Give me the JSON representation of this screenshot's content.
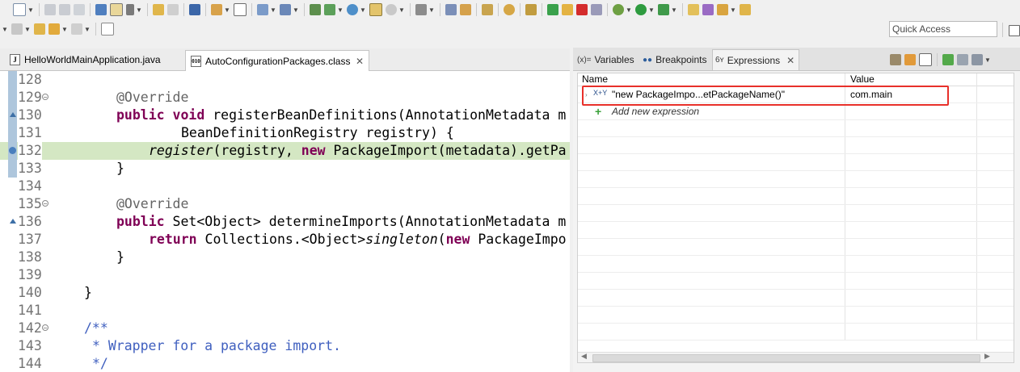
{
  "toolbar": {
    "quick_access_placeholder": "Quick Access"
  },
  "editor": {
    "tabs": [
      {
        "label": "HelloWorldMainApplication.java",
        "icon": "java-file-icon"
      },
      {
        "label": "AutoConfigurationPackages.class",
        "icon": "class-file-icon",
        "active": true
      }
    ],
    "lines": [
      {
        "num": "128",
        "text": ""
      },
      {
        "num": "129",
        "text": "@Override"
      },
      {
        "num": "130",
        "text": "public void registerBeanDefinitions(AnnotationMetadata m"
      },
      {
        "num": "131",
        "text": "BeanDefinitionRegistry registry) {"
      },
      {
        "num": "132",
        "text": "register(registry, new PackageImport(metadata).getPa"
      },
      {
        "num": "133",
        "text": "}"
      },
      {
        "num": "134",
        "text": ""
      },
      {
        "num": "135",
        "text": "@Override"
      },
      {
        "num": "136",
        "text": "public Set<Object> determineImports(AnnotationMetadata m"
      },
      {
        "num": "137",
        "text": "return Collections.<Object>singleton(new PackageImpo"
      },
      {
        "num": "138",
        "text": "}"
      },
      {
        "num": "139",
        "text": ""
      },
      {
        "num": "140",
        "text": "}"
      },
      {
        "num": "141",
        "text": ""
      },
      {
        "num": "142",
        "text": "/**"
      },
      {
        "num": "143",
        "text": "* Wrapper for a package import."
      },
      {
        "num": "144",
        "text": "*/"
      }
    ],
    "current_line": "132",
    "current_line_color": "#d4e7c3"
  },
  "debug_view": {
    "tabs": {
      "variables": "Variables",
      "breakpoints": "Breakpoints",
      "expressions": "Expressions"
    },
    "columns": {
      "name": "Name",
      "value": "Value"
    },
    "expressions": [
      {
        "name": "\"new PackageImpo...etPackageName()\"",
        "value": "com.main"
      }
    ],
    "add_new_expression": "Add new expression",
    "highlight_color": "#e8302a"
  },
  "colors": {
    "keyword": "#7f0055",
    "annotation": "#646464",
    "javadoc": "#3f5fbf"
  }
}
